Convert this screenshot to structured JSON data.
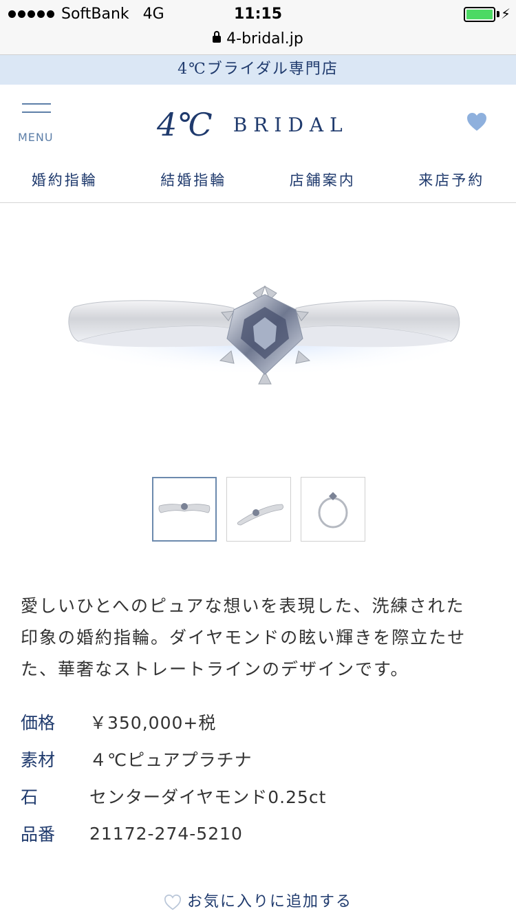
{
  "status_bar": {
    "carrier": "SoftBank",
    "network": "4G",
    "time": "11:15"
  },
  "browser": {
    "url": "4-bridal.jp"
  },
  "band": {
    "text": "4℃ブライダル専門店"
  },
  "header": {
    "menu_label": "MENU",
    "logo_mark": "4℃",
    "logo_text": "BRIDAL"
  },
  "nav": {
    "items": [
      {
        "label": "婚約指輪"
      },
      {
        "label": "結婚指輪"
      },
      {
        "label": "店舗案内"
      },
      {
        "label": "来店予約"
      }
    ]
  },
  "product": {
    "description_lines": [
      "愛しいひとへのピュアな想いを表現した、洗練された",
      "印象の婚約指輪。ダイヤモンドの眩い輝きを際立たせ",
      "た、華奢なストレートラインのデザインです。"
    ],
    "specs": [
      {
        "label": "価格",
        "value": "￥350,000+税"
      },
      {
        "label": "素材",
        "value": "４℃ピュアプラチナ"
      },
      {
        "label": "石",
        "value": "センターダイヤモンド0.25ct"
      },
      {
        "label": "品番",
        "value": "21172-274-5210"
      }
    ],
    "favorite_label": "お気に入りに追加する"
  },
  "colors": {
    "brand": "#1f3a6d",
    "band_bg": "#dbe7f5",
    "heart": "#8eb0dd",
    "battery": "#4cd964"
  }
}
